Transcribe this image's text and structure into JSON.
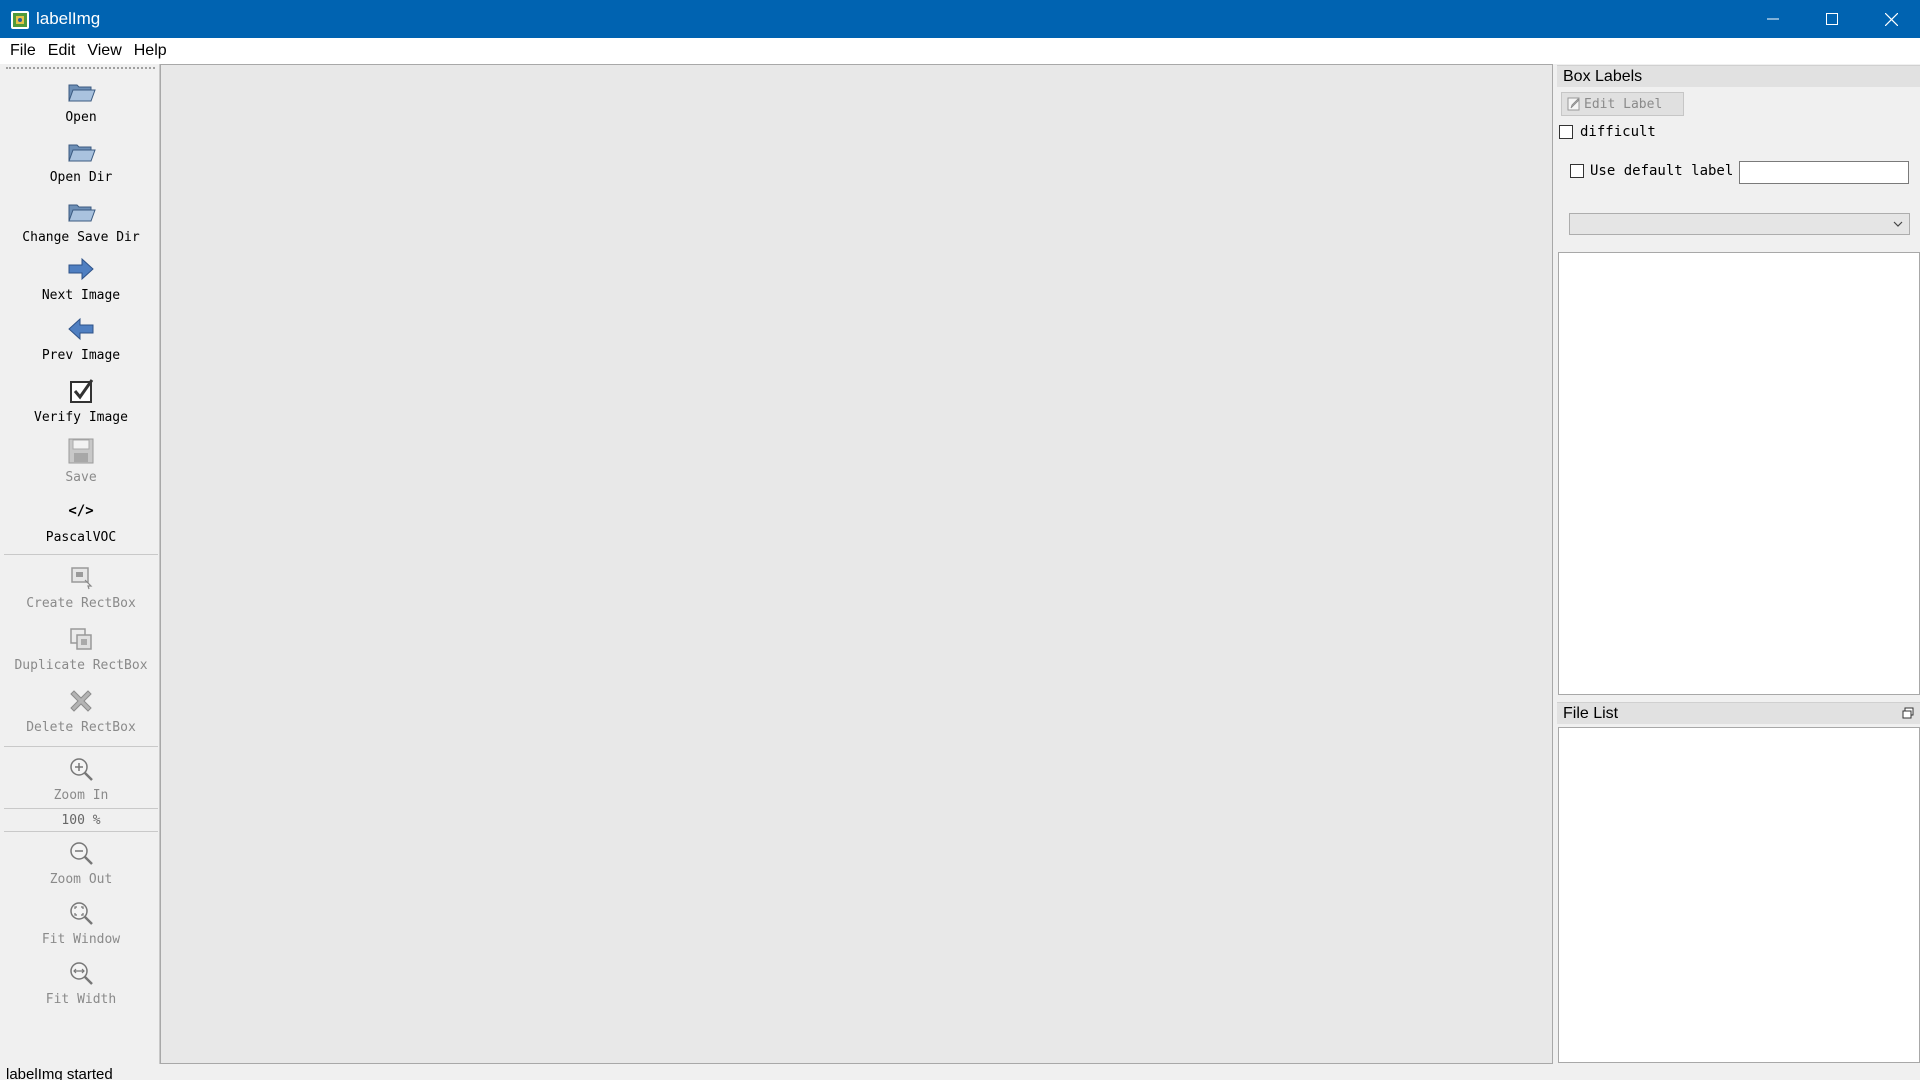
{
  "window": {
    "title": "labelImg",
    "icon": "labelimg-app-icon",
    "titlebar_color": "#0063b1"
  },
  "menu": [
    "File",
    "Edit",
    "View",
    "Help"
  ],
  "toolbar": {
    "open": {
      "label": "Open",
      "icon": "folder-open-icon"
    },
    "open_dir": {
      "label": "Open Dir",
      "icon": "folder-open-icon"
    },
    "change_save_dir": {
      "label": "Change Save Dir",
      "icon": "folder-open-icon"
    },
    "next_image": {
      "label": "Next Image",
      "icon": "arrow-right-icon"
    },
    "prev_image": {
      "label": "Prev Image",
      "icon": "arrow-left-icon"
    },
    "verify_image": {
      "label": "Verify Image",
      "icon": "checkbox-icon"
    },
    "save": {
      "label": "Save",
      "icon": "floppy-icon"
    },
    "format": {
      "label": "PascalVOC",
      "icon": "code-icon",
      "icon_text": "</>"
    },
    "create_rectbox": {
      "label": "Create RectBox",
      "icon": "rectbox-icon"
    },
    "duplicate_rectbox": {
      "label": "Duplicate RectBox",
      "icon": "duplicate-icon"
    },
    "delete_rectbox": {
      "label": "Delete RectBox",
      "icon": "delete-x-icon"
    },
    "zoom_in": {
      "label": "Zoom In",
      "icon": "zoom-in-icon"
    },
    "zoom_value": "100 %",
    "zoom_out": {
      "label": "Zoom Out",
      "icon": "zoom-out-icon"
    },
    "fit_window": {
      "label": "Fit Window",
      "icon": "fit-window-icon"
    },
    "fit_width": {
      "label": "Fit Width",
      "icon": "fit-width-icon"
    }
  },
  "box_labels": {
    "title": "Box Labels",
    "edit_label": "Edit Label",
    "difficult": "difficult",
    "use_default_label": "Use default label",
    "default_label_value": ""
  },
  "file_list": {
    "title": "File List"
  },
  "status": "labelImg started"
}
